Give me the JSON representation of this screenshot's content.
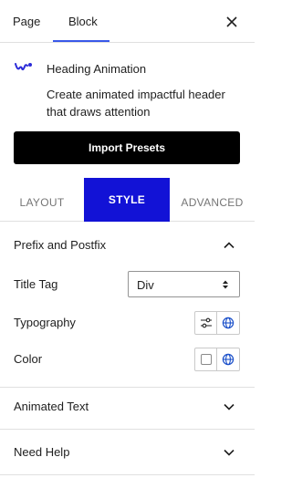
{
  "top_tabs": {
    "page": "Page",
    "block": "Block",
    "active": "Block",
    "accent": "#3858e9"
  },
  "block": {
    "title": "Heading Animation",
    "description": "Create animated impactful header that draws attention",
    "icon": "heading-animation-icon",
    "icon_color": "#2b2bd8"
  },
  "import_button": "Import Presets",
  "mode_tabs": {
    "layout": "LAYOUT",
    "style": "STYLE",
    "advanced": "ADVANCED",
    "active": "STYLE",
    "active_color": "#1212d6"
  },
  "sections": {
    "prefix_postfix": {
      "title": "Prefix and Postfix",
      "expanded": true,
      "title_tag": {
        "label": "Title Tag",
        "value": "Div"
      },
      "typography": {
        "label": "Typography"
      },
      "color": {
        "label": "Color"
      }
    },
    "animated_text": {
      "title": "Animated Text",
      "expanded": false
    },
    "need_help": {
      "title": "Need Help",
      "expanded": false
    }
  }
}
